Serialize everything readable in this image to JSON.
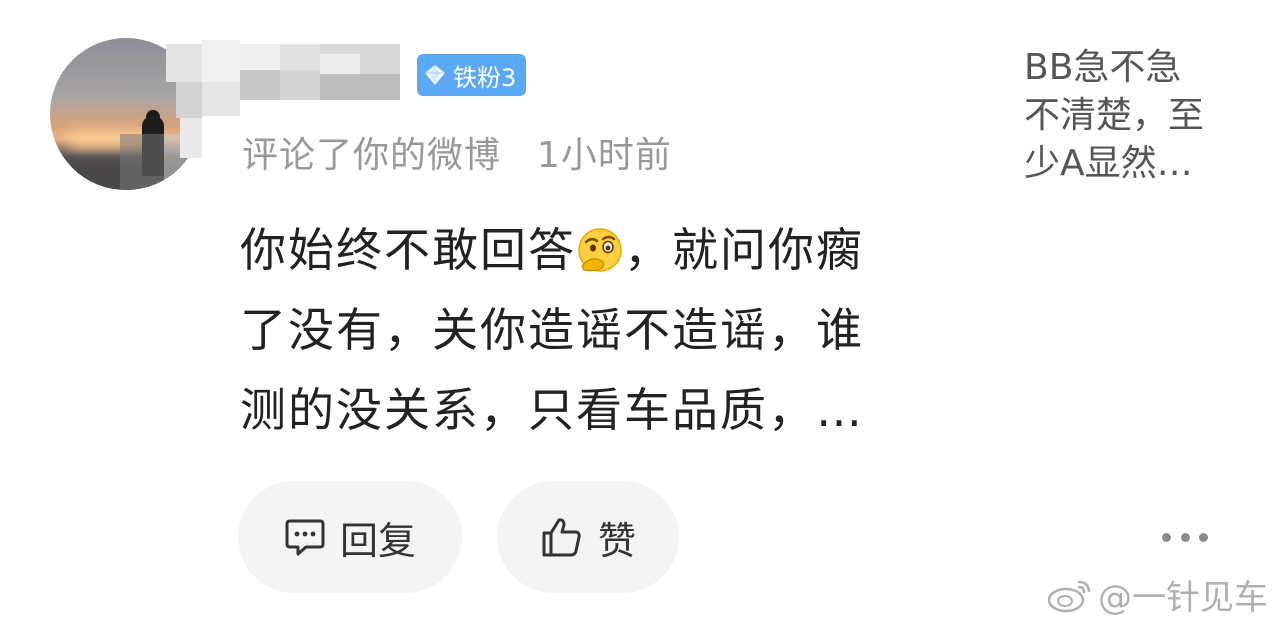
{
  "user": {
    "badge_label": "铁粉3"
  },
  "meta": {
    "action": "评论了你的微博",
    "time": "1小时前"
  },
  "comment": {
    "line1_before_emoji": "你始终不敢回答",
    "emoji": "thinking-face-emoji",
    "line1_after_emoji": "，就问你瘸",
    "line2": "了没有，关你造谣不造谣，谁",
    "line3": "测的没关系，只看车品质，…"
  },
  "actions": {
    "reply_label": "回复",
    "like_label": "赞"
  },
  "original_post": {
    "line1": "BB急不急",
    "line2": "不清楚，至",
    "line3": "少A显然…"
  },
  "watermark": {
    "text": "@一针见车"
  },
  "colors": {
    "badge_bg": "#5ba8f5",
    "meta_text": "#999999",
    "comment_text": "#222222",
    "button_bg": "#f4f4f4"
  }
}
